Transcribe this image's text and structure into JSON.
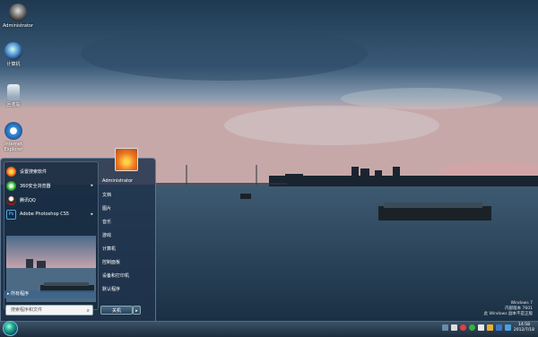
{
  "desktop": {
    "icons": [
      {
        "label": "Administrator",
        "icon": "user-folder-icon"
      },
      {
        "label": "计算机",
        "icon": "computer-icon"
      },
      {
        "label": "回收站",
        "icon": "recycle-bin-icon"
      },
      {
        "label": "Internet Explorer",
        "icon": "ie-icon"
      }
    ]
  },
  "start_menu": {
    "programs": [
      {
        "label": "设置搜索软件",
        "icon": "flower-icon"
      },
      {
        "label": "360安全浏览器",
        "icon": "browser-360-icon",
        "has_submenu": true
      },
      {
        "label": "腾讯QQ",
        "icon": "qq-penguin-icon"
      },
      {
        "label": "Adobe Photoshop CS5",
        "icon": "photoshop-icon",
        "has_submenu": true
      }
    ],
    "all_programs": "所有程序",
    "search_placeholder": "搜索程序和文件",
    "right_items": [
      "Administrator",
      "文档",
      "图片",
      "音乐",
      "游戏",
      "计算机",
      "控制面板",
      "设备和打印机",
      "默认程序"
    ],
    "shutdown_label": "关机"
  },
  "taskbar": {
    "time": "14:58",
    "date": "2012/7/18"
  },
  "watermark": {
    "line1": "Windows 7",
    "line2": "内部版本 7601",
    "line3": "此 Windows 副本不是正版"
  }
}
